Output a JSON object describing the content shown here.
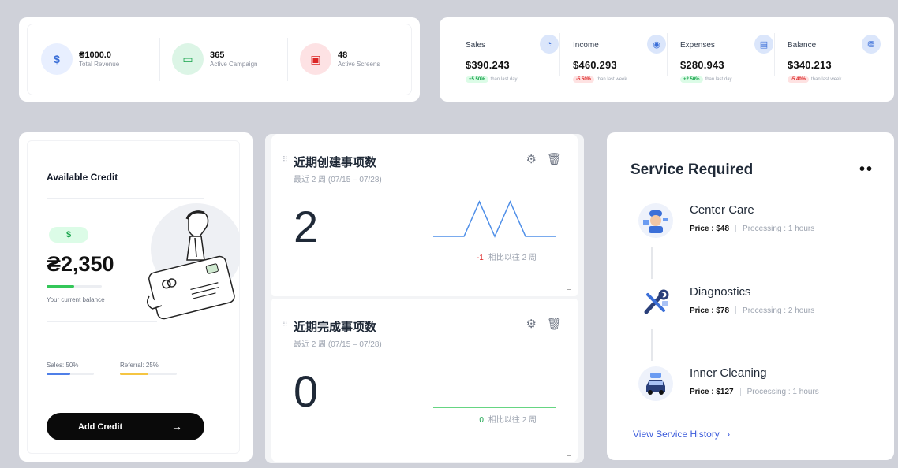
{
  "stats_left": [
    {
      "value": "₴1000.0",
      "label": "Total Revenue",
      "icon": "dollar-icon",
      "symbol": "$",
      "bg": "#e8efff",
      "fg": "#3b6fd8"
    },
    {
      "value": "365",
      "label": "Active Campaign",
      "icon": "ticket-icon",
      "symbol": "▭",
      "bg": "#dcf5e6",
      "fg": "#16a34a"
    },
    {
      "value": "48",
      "label": "Active Screens",
      "icon": "monitor-icon",
      "symbol": "▣",
      "bg": "#fde2e4",
      "fg": "#dc2626"
    }
  ],
  "stats_right": [
    {
      "label": "Sales",
      "value": "$390.243",
      "change": "+5.50%",
      "dir": "up",
      "note": "than last day",
      "icon": "sales-icon",
      "symbol": "◔"
    },
    {
      "label": "Income",
      "value": "$460.293",
      "change": "-5.50%",
      "dir": "down",
      "note": "than last week",
      "icon": "income-icon",
      "symbol": "◉"
    },
    {
      "label": "Expenses",
      "value": "$280.943",
      "change": "+2.50%",
      "dir": "up",
      "note": "than last day",
      "icon": "expenses-icon",
      "symbol": "▤"
    },
    {
      "label": "Balance",
      "value": "$340.213",
      "change": "-5.40%",
      "dir": "down",
      "note": "than last week",
      "icon": "balance-icon",
      "symbol": "⛃"
    }
  ],
  "credit": {
    "title": "Available Credit",
    "currency_badge": "$",
    "balance": "₴2,350",
    "caption": "Your current balance",
    "sales_label": "Sales: 50%",
    "sales_pct": 0.5,
    "referral_label": "Referral: 25%",
    "referral_pct": 0.5,
    "button": "Add Credit",
    "colors": {
      "green": "#34c759",
      "blue": "#4f7fe8",
      "yellow": "#f5c542"
    }
  },
  "metrics": [
    {
      "title": "近期创建事项数",
      "subtitle": "最近 2 周 (07/15 – 07/28)",
      "value": "2",
      "delta": "-1",
      "delta_color": "#dc2626",
      "delta_label": "相比以往 2 周",
      "spark": [
        0,
        0,
        0,
        1,
        0,
        1,
        0,
        0,
        0
      ]
    },
    {
      "title": "近期完成事项数",
      "subtitle": "最近 2 周 (07/15 – 07/28)",
      "value": "0",
      "delta": "0",
      "delta_color": "#16a34a",
      "delta_label": "相比以往 2 周",
      "spark": [
        0,
        0,
        0,
        0,
        0,
        0,
        0,
        0,
        0
      ]
    }
  ],
  "service": {
    "title": "Service Required",
    "price_label": "Price :",
    "processing_label": "Processing :",
    "items": [
      {
        "name": "Center Care",
        "price": "$48",
        "processing": "1 hours",
        "icon": "mechanic-icon"
      },
      {
        "name": "Diagnostics",
        "price": "$78",
        "processing": "2 hours",
        "icon": "tools-icon"
      },
      {
        "name": "Inner Cleaning",
        "price": "$127",
        "processing": "1 hours",
        "icon": "car-wash-icon"
      }
    ],
    "history_link": "View Service History",
    "history_arrow": "›"
  }
}
